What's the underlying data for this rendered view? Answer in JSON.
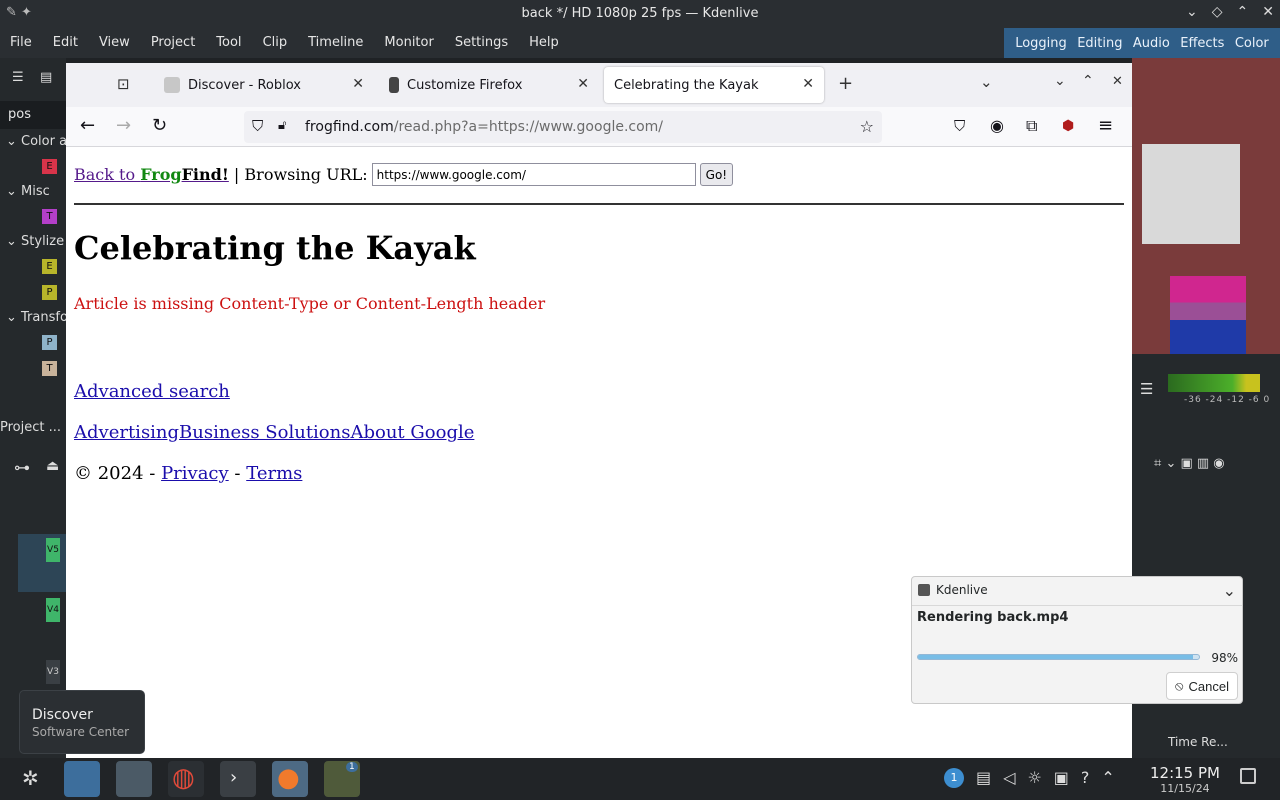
{
  "kdenlive": {
    "window_title": "back */ HD 1080p 25 fps — Kdenlive",
    "menu": [
      "File",
      "Edit",
      "View",
      "Project",
      "Tool",
      "Clip",
      "Timeline",
      "Monitor",
      "Settings",
      "Help"
    ],
    "workspaces": [
      "Logging",
      "Editing",
      "Audio",
      "Effects",
      "Color"
    ],
    "effects_search": "pos",
    "effect_groups": [
      "Color a",
      "Misc",
      "Stylize",
      "Transfo"
    ],
    "group_badges": [
      "E",
      "T",
      "E",
      "P",
      "P",
      "T"
    ],
    "project_label": "Project ...",
    "tracks": [
      "V5",
      "V4",
      "V3"
    ],
    "meter_labels": "-36 -24  -12 -6  0",
    "right_tab": "Time Re..."
  },
  "firefox": {
    "tabs": [
      {
        "label": "Discover - Roblox"
      },
      {
        "label": "Customize Firefox"
      },
      {
        "label": "Celebrating the Kayak"
      }
    ],
    "url_host": "frogfind.com",
    "url_path": "/read.php?a=https://www.google.com/"
  },
  "page": {
    "back_prefix": "Back to ",
    "back_frog": "Frog",
    "back_find": "Find!",
    "separator": " | ",
    "browsing_label": "Browsing URL:",
    "url_value": "https://www.google.com/",
    "go_label": "Go!",
    "heading": "Celebrating the Kayak",
    "error": "Article is missing Content-Type or Content-Length header",
    "advanced_search": "Advanced search",
    "link_advertising": "Advertising",
    "link_business": "Business Solutions",
    "link_about": "About Google",
    "copyright": "© 2024 - ",
    "privacy": "Privacy",
    "dash": " - ",
    "terms": "Terms"
  },
  "notification": {
    "app": "Kdenlive",
    "title": "Rendering back.mp4",
    "progress": 0.98,
    "percent_text": "98%",
    "cancel_label": "Cancel"
  },
  "tooltip": {
    "title": "Discover",
    "subtitle": "Software Center"
  },
  "taskbar": {
    "time": "12:15 PM",
    "date": "11/15/24",
    "badge_count": "1"
  }
}
